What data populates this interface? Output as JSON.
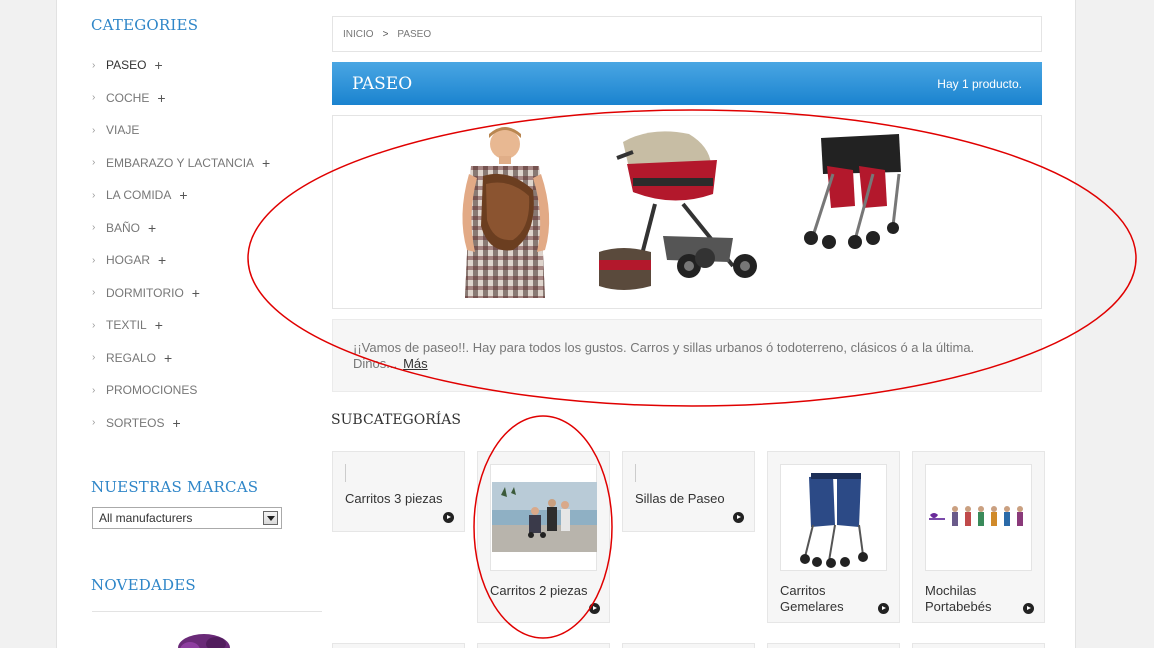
{
  "sidebar": {
    "categories_title": "CATEGORIES",
    "categories": [
      {
        "label": "PASEO",
        "expandable": true,
        "active": true
      },
      {
        "label": "COCHE",
        "expandable": true
      },
      {
        "label": "VIAJE",
        "expandable": false
      },
      {
        "label": "EMBARAZO Y LACTANCIA",
        "expandable": true
      },
      {
        "label": "LA COMIDA",
        "expandable": true
      },
      {
        "label": "BAÑO",
        "expandable": true
      },
      {
        "label": "HOGAR",
        "expandable": true
      },
      {
        "label": "DORMITORIO",
        "expandable": true
      },
      {
        "label": "TEXTIL",
        "expandable": true
      },
      {
        "label": "REGALO",
        "expandable": true
      },
      {
        "label": "PROMOCIONES",
        "expandable": false
      },
      {
        "label": "SORTEOS",
        "expandable": true
      }
    ],
    "plus_glyph": "+",
    "chevron_glyph": "›",
    "brands_title": "NUESTRAS MARCAS",
    "brands_select_value": "All manufacturers",
    "new_title": "NOVEDADES"
  },
  "breadcrumb": {
    "home": "INICIO",
    "separator": ">",
    "current": "PASEO"
  },
  "category_header": {
    "name": "PASEO",
    "count_text": "Hay 1 producto."
  },
  "description": {
    "text": "¡¡Vamos de paseo!!. Hay para todos los gustos. Carros y sillas urbanos ó todoterreno, clásicos ó a la última. Dinos...",
    "more_label": "Más"
  },
  "subcategories": {
    "title": "SUBCATEGORÍAS",
    "items": [
      {
        "label": "Carritos 3 piezas",
        "has_image": false
      },
      {
        "label": "Carritos 2 piezas",
        "has_image": true
      },
      {
        "label": "Sillas de Paseo",
        "has_image": false
      },
      {
        "label": "Carritos Gemelares",
        "has_image": true
      },
      {
        "label": "Mochilas Portabebés",
        "has_image": true
      }
    ]
  },
  "colors": {
    "accent_blue": "#2f86c8",
    "header_gradient_top": "#4aa6e3",
    "header_gradient_bottom": "#1a83cf",
    "annotation_red": "#e00000",
    "stroller_red": "#b3182c"
  }
}
